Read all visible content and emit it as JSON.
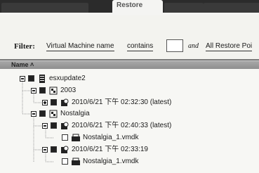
{
  "tabs": [
    "",
    "",
    "Restore",
    "",
    ""
  ],
  "filter": {
    "label": "Filter:",
    "field": "Virtual Machine name",
    "operator": "contains",
    "value": "",
    "joiner": "and",
    "scope": "All Restore Poi"
  },
  "tree": {
    "header": "Name ˄",
    "nodes": [
      {
        "label": "esxupdate2",
        "icon": "server-icon"
      },
      {
        "label": "2003",
        "icon": "vm-group-icon"
      },
      {
        "label": "2010/6/21 下午 02:32:30 (latest)",
        "icon": "restore-point-icon"
      },
      {
        "label": "Nostalgia",
        "icon": "vm-group-icon"
      },
      {
        "label": "2010/6/21 下午 02:40:33 (latest)",
        "icon": "restore-point-icon"
      },
      {
        "label": "Nostalgia_1.vmdk",
        "icon": "disk-icon"
      },
      {
        "label": "2010/6/21 下午 02:33:19",
        "icon": "restore-point-icon"
      },
      {
        "label": "Nostalgia_1.vmdk",
        "icon": "disk-icon"
      }
    ]
  }
}
